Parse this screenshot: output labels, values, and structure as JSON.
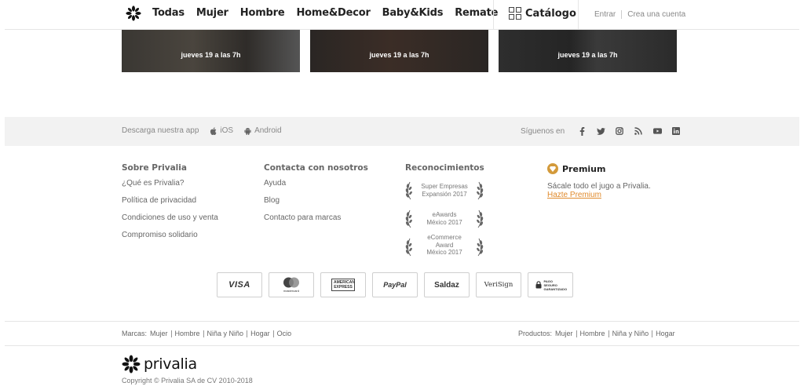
{
  "header": {
    "nav": [
      "Todas",
      "Mujer",
      "Hombre",
      "Home&Decor",
      "Baby&Kids",
      "Remate"
    ],
    "catalog_label": "Catálogo",
    "login_label": "Entrar",
    "signup_label": "Crea una cuenta"
  },
  "campaigns": [
    {
      "date": "jueves 19 a las 7h"
    },
    {
      "date": "jueves 19 a las 7h"
    },
    {
      "date": "jueves 19 a las 7h"
    }
  ],
  "app_band": {
    "download_label": "Descarga nuestra app",
    "ios_label": "iOS",
    "android_label": "Android",
    "follow_label": "Síguenos en",
    "social_icons": [
      "facebook-icon",
      "twitter-icon",
      "instagram-icon",
      "rss-icon",
      "youtube-icon",
      "linkedin-icon"
    ]
  },
  "footer": {
    "about": {
      "title": "Sobre Privalia",
      "links": [
        "¿Qué es Privalia?",
        "Política de privacidad",
        "Condiciones de uso y venta",
        "Compromiso solidario"
      ]
    },
    "contact": {
      "title": "Contacta con nosotros",
      "links": [
        "Ayuda",
        "Blog",
        "Contacto para marcas"
      ]
    },
    "awards": {
      "title": "Reconocimientos",
      "items": [
        "Super Empresas\nExpansión 2017",
        "eAwards\nMéxico 2017",
        "eCommerce\nAward\nMéxico 2017"
      ]
    },
    "premium": {
      "title": "Premium",
      "description": "Sácale todo el jugo a Privalia.",
      "link": "Hazte Premium",
      "accent_color": "#d39a3b"
    }
  },
  "payments": [
    "VISA",
    "mastercard",
    "AMERICAN EXPRESS",
    "PayPal",
    "Saldaz",
    "VeriSign",
    "PAGO SEGURO GARANTIZADO"
  ],
  "brands_row": {
    "label": "Marcas:",
    "items": [
      "Mujer",
      "Hombre",
      "Niña y Niño",
      "Hogar",
      "Ocio"
    ]
  },
  "products_row": {
    "label": "Productos:",
    "items": [
      "Mujer",
      "Hombre",
      "Niña y Niño",
      "Hogar"
    ]
  },
  "brand_name": "privalia",
  "copyright": "Copyright © Privalia SA de CV 2010-2018"
}
